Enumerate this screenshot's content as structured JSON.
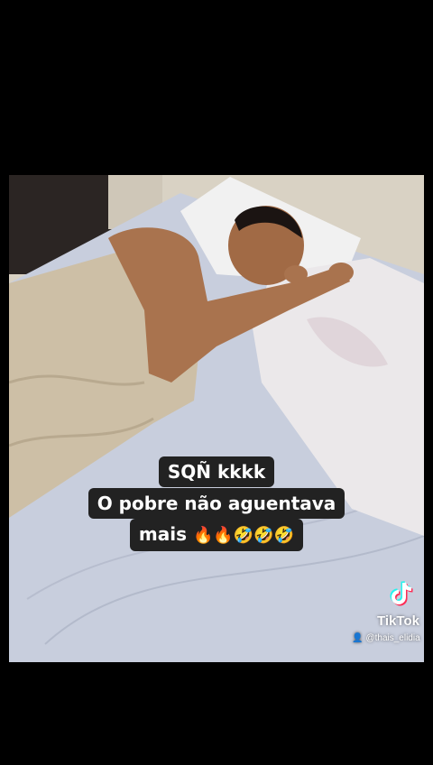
{
  "caption": {
    "line1": "SQÑ kkkk",
    "line2": "O pobre não aguentava",
    "line3_text": "mais",
    "line3_emojis": "🔥🔥🤣🤣🤣"
  },
  "watermark": {
    "brand": "TikTok",
    "username": "@thais_elidia",
    "icon": "tiktok-note-icon",
    "user_icon": "person-icon"
  },
  "colors": {
    "background": "#000000",
    "caption_bg": "#222222",
    "caption_text": "#ffffff"
  }
}
